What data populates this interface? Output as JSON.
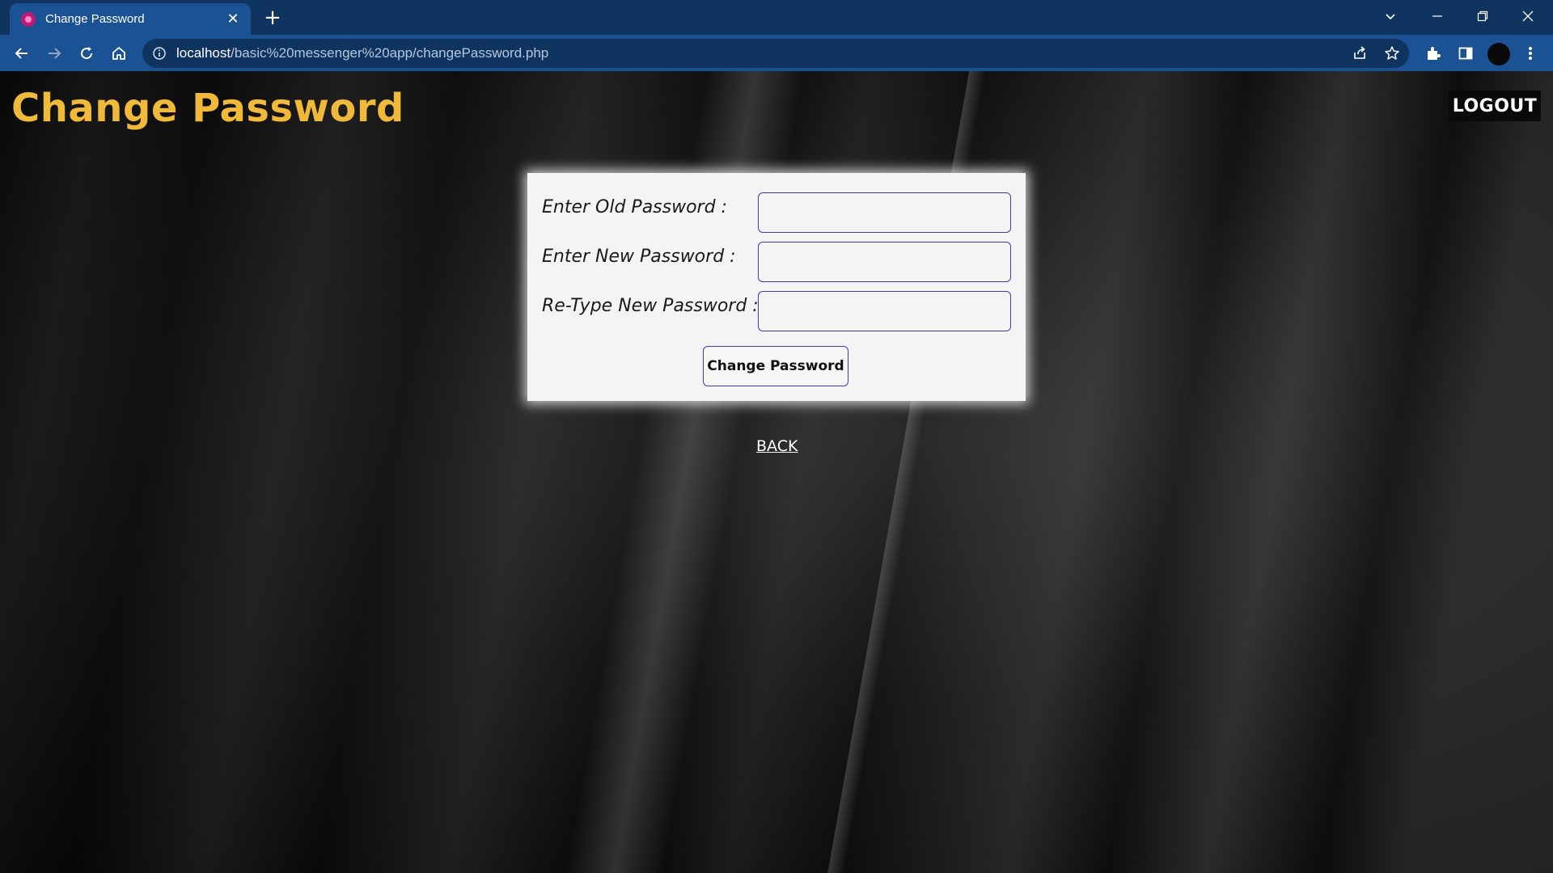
{
  "browser": {
    "tab_title": "Change Password",
    "tab_close": "✕",
    "new_tab": "+",
    "url_host": "localhost",
    "url_path": "/basic%20messenger%20app/changePassword.php"
  },
  "page": {
    "title": "Change Password",
    "logout_label": "LOGOUT",
    "back_label": "BACK"
  },
  "form": {
    "old_password_label": "Enter Old Password :",
    "new_password_label": "Enter New Password :",
    "retype_password_label": "Re-Type New Password :",
    "old_password_value": "",
    "new_password_value": "",
    "retype_password_value": "",
    "submit_label": "Change Password"
  },
  "colors": {
    "chrome_dark": "#0f3460",
    "chrome_tab": "#1a5294",
    "title_accent": "#f0b93a",
    "input_border": "#3b3bb8",
    "card_bg": "#f4f4f4"
  }
}
